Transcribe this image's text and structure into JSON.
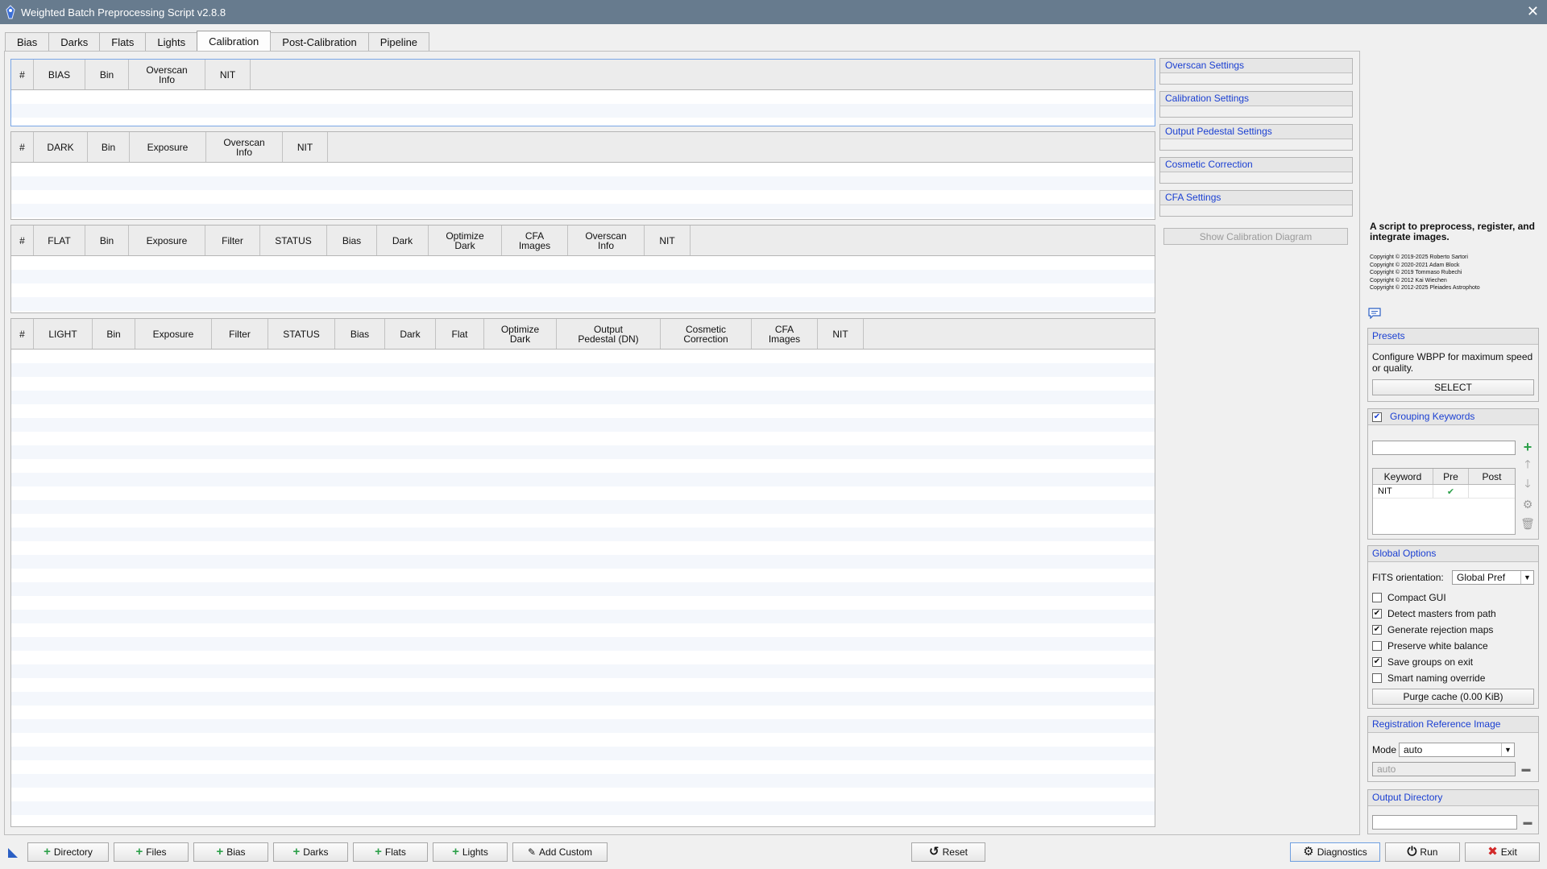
{
  "window": {
    "title": "Weighted Batch Preprocessing Script v2.8.8"
  },
  "tabs": [
    {
      "label": "Bias"
    },
    {
      "label": "Darks"
    },
    {
      "label": "Flats"
    },
    {
      "label": "Lights"
    },
    {
      "label": "Calibration",
      "active": true
    },
    {
      "label": "Post-Calibration"
    },
    {
      "label": "Pipeline"
    }
  ],
  "tables": {
    "bias": {
      "columns": [
        "#",
        "BIAS",
        "Bin",
        "Overscan\nInfo",
        "NIT"
      ]
    },
    "dark": {
      "columns": [
        "#",
        "DARK",
        "Bin",
        "Exposure",
        "Overscan\nInfo",
        "NIT"
      ]
    },
    "flat": {
      "columns": [
        "#",
        "FLAT",
        "Bin",
        "Exposure",
        "Filter",
        "STATUS",
        "Bias",
        "Dark",
        "Optimize\nDark",
        "CFA\nImages",
        "Overscan\nInfo",
        "NIT"
      ]
    },
    "light": {
      "columns": [
        "#",
        "LIGHT",
        "Bin",
        "Exposure",
        "Filter",
        "STATUS",
        "Bias",
        "Dark",
        "Flat",
        "Optimize\nDark",
        "Output\nPedestal (DN)",
        "Cosmetic\nCorrection",
        "CFA\nImages",
        "NIT"
      ]
    }
  },
  "settings_sections": [
    {
      "label": "Overscan Settings"
    },
    {
      "label": "Calibration Settings"
    },
    {
      "label": "Output Pedestal Settings"
    },
    {
      "label": "Cosmetic Correction"
    },
    {
      "label": "CFA Settings"
    }
  ],
  "show_diagram_label": "Show Calibration Diagram",
  "info": {
    "description": "A script to preprocess, register, and integrate images.",
    "copyright": [
      "Copyright © 2019-2025 Roberto Sartori",
      "Copyright © 2020-2021 Adam Block",
      "Copyright © 2019 Tommaso Rubechi",
      "Copyright © 2012 Kai Wiechen",
      "Copyright © 2012-2025 Pleiades Astrophoto"
    ]
  },
  "presets": {
    "title": "Presets",
    "text": "Configure WBPP for maximum speed or quality.",
    "button": "SELECT"
  },
  "grouping": {
    "title": "Grouping Keywords",
    "enabled": true,
    "input_value": "",
    "columns": [
      "Keyword",
      "Pre",
      "Post"
    ],
    "rows": [
      {
        "keyword": "NIT",
        "pre": "✔",
        "post": ""
      }
    ]
  },
  "global_options": {
    "title": "Global Options",
    "fits_label": "FITS orientation:",
    "fits_value": "Global Pref",
    "options": [
      {
        "label": "Compact GUI",
        "checked": false,
        "mark": ""
      },
      {
        "label": "Detect masters from path",
        "checked": true,
        "mark": "✔"
      },
      {
        "label": "Generate rejection maps",
        "checked": true,
        "mark": "✔"
      },
      {
        "label": "Preserve white balance",
        "checked": false,
        "mark": ""
      },
      {
        "label": "Save groups on exit",
        "checked": true,
        "mark": "✔"
      },
      {
        "label": "Smart naming override",
        "checked": false,
        "mark": ""
      }
    ],
    "purge_button": "Purge cache (0.00 KiB)"
  },
  "registration": {
    "title": "Registration Reference Image",
    "mode_label": "Mode",
    "mode_value": "auto",
    "ref_value": "auto"
  },
  "output_directory": {
    "title": "Output Directory",
    "value": ""
  },
  "bottom_bar": {
    "directory": "Directory",
    "files": "Files",
    "bias": "Bias",
    "darks": "Darks",
    "flats": "Flats",
    "lights": "Lights",
    "add_custom": "Add Custom",
    "reset": "Reset",
    "diagnostics": "Diagnostics",
    "run": "Run",
    "exit": "Exit"
  },
  "colors": {
    "titlebar": "#677b8e",
    "link_blue": "#1a3fd2",
    "plus_green": "#2da04a",
    "exit_red": "#d22a2a"
  }
}
